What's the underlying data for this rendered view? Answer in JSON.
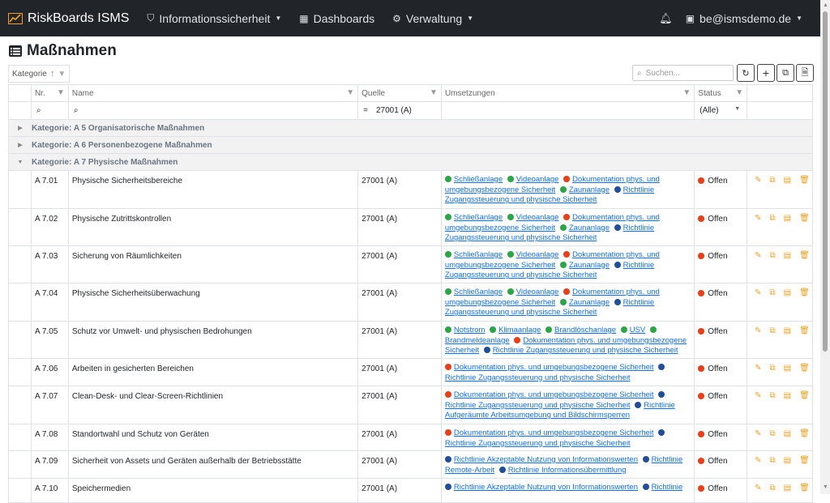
{
  "nav": {
    "brand": "RiskBoards ISMS",
    "items": [
      {
        "label": "Informationssicherheit",
        "icon": "shield-icon"
      },
      {
        "label": "Dashboards",
        "icon": "grid-icon"
      },
      {
        "label": "Verwaltung",
        "icon": "gear-icon"
      }
    ],
    "user": "be@ismsdemo.de"
  },
  "page": {
    "title": "Maßnahmen"
  },
  "toolbar": {
    "group_label": "Kategorie",
    "search_placeholder": "Suchen..."
  },
  "columns": {
    "nr": "Nr.",
    "name": "Name",
    "quelle": "Quelle",
    "umsetzungen": "Umsetzungen",
    "status": "Status"
  },
  "filters": {
    "quelle": "27001 (A)",
    "status": "(Alle)"
  },
  "colors": {
    "green": "#28a745",
    "red": "#f03c14",
    "blue": "#1f4e9c",
    "action": "#f0a020"
  },
  "groups": [
    {
      "label": "Kategorie: A 5 Organisatorische Maßnahmen",
      "expanded": false
    },
    {
      "label": "Kategorie: A 6 Personenbezogene Maßnahmen",
      "expanded": false
    },
    {
      "label": "Kategorie: A 7 Physische Maßnahmen",
      "expanded": true
    }
  ],
  "rows": [
    {
      "nr": "A 7.01",
      "name": "Physische Sicherheitsbereiche",
      "quelle": "27001 (A)",
      "status": "Offen",
      "impl": [
        [
          "green",
          "Schließanlage"
        ],
        [
          "green",
          "Videoanlage"
        ],
        [
          "red",
          "Dokumentation phys. und umgebungsbezogene Sicherheit"
        ],
        [
          "green",
          "Zaunanlage"
        ],
        [
          "blue",
          "Richtlinie Zugangssteuerung und physische Sicherheit"
        ]
      ]
    },
    {
      "nr": "A 7.02",
      "name": "Physische Zutrittskontrollen",
      "quelle": "27001 (A)",
      "status": "Offen",
      "impl": [
        [
          "green",
          "Schließanlage"
        ],
        [
          "green",
          "Videoanlage"
        ],
        [
          "red",
          "Dokumentation phys. und umgebungsbezogene Sicherheit"
        ],
        [
          "green",
          "Zaunanlage"
        ],
        [
          "blue",
          "Richtlinie Zugangssteuerung und physische Sicherheit"
        ]
      ]
    },
    {
      "nr": "A 7.03",
      "name": "Sicherung von Räumlichkeiten",
      "quelle": "27001 (A)",
      "status": "Offen",
      "impl": [
        [
          "green",
          "Schließanlage"
        ],
        [
          "green",
          "Videoanlage"
        ],
        [
          "red",
          "Dokumentation phys. und umgebungsbezogene Sicherheit"
        ],
        [
          "green",
          "Zaunanlage"
        ],
        [
          "blue",
          "Richtlinie Zugangssteuerung und physische Sicherheit"
        ]
      ]
    },
    {
      "nr": "A 7.04",
      "name": "Physische Sicherheitsüberwachung",
      "quelle": "27001 (A)",
      "status": "Offen",
      "impl": [
        [
          "green",
          "Schließanlage"
        ],
        [
          "green",
          "Videoanlage"
        ],
        [
          "red",
          "Dokumentation phys. und umgebungsbezogene Sicherheit"
        ],
        [
          "green",
          "Zaunanlage"
        ],
        [
          "blue",
          "Richtlinie Zugangssteuerung und physische Sicherheit"
        ]
      ]
    },
    {
      "nr": "A 7.05",
      "name": "Schutz vor Umwelt- und physischen Bedrohungen",
      "quelle": "27001 (A)",
      "status": "Offen",
      "impl": [
        [
          "green",
          "Notstrom"
        ],
        [
          "green",
          "Klimaanlage"
        ],
        [
          "green",
          "Brandlöschanlage"
        ],
        [
          "green",
          "USV"
        ],
        [
          "green",
          "Brandmeldeanlage"
        ],
        [
          "red",
          "Dokumentation phys. und umgebungsbezogene Sicherheit"
        ],
        [
          "blue",
          "Richtlinie Zugangssteuerung und physische Sicherheit"
        ]
      ]
    },
    {
      "nr": "A 7.06",
      "name": "Arbeiten in gesicherten Bereichen",
      "quelle": "27001 (A)",
      "status": "Offen",
      "impl": [
        [
          "red",
          "Dokumentation phys. und umgebungsbezogene Sicherheit"
        ],
        [
          "blue",
          "Richtlinie Zugangssteuerung und physische Sicherheit"
        ]
      ]
    },
    {
      "nr": "A 7.07",
      "name": "Clean-Desk- und Clear-Screen-Richtlinien",
      "quelle": "27001 (A)",
      "status": "Offen",
      "impl": [
        [
          "red",
          "Dokumentation phys. und umgebungsbezogene Sicherheit"
        ],
        [
          "blue",
          "Richtlinie Zugangssteuerung und physische Sicherheit"
        ],
        [
          "blue",
          "Richtlinie Aufgeräumte Arbeitsumgebung und Bildschirmsperren"
        ]
      ]
    },
    {
      "nr": "A 7.08",
      "name": "Standortwahl und Schutz von Geräten",
      "quelle": "27001 (A)",
      "status": "Offen",
      "impl": [
        [
          "red",
          "Dokumentation phys. und umgebungsbezogene Sicherheit"
        ],
        [
          "blue",
          "Richtlinie Zugangssteuerung und physische Sicherheit"
        ]
      ]
    },
    {
      "nr": "A 7.09",
      "name": "Sicherheit von Assets und Geräten außerhalb der Betriebsstätte",
      "quelle": "27001 (A)",
      "status": "Offen",
      "impl": [
        [
          "blue",
          "Richtlinie Akzeptable Nutzung von Informationswerten"
        ],
        [
          "blue",
          "Richtlinie Remote-Arbeit"
        ],
        [
          "blue",
          "Richtlinie Informationsübermittlung"
        ]
      ]
    },
    {
      "nr": "A 7.10",
      "name": "Speichermedien",
      "quelle": "27001 (A)",
      "status": "Offen",
      "impl": [
        [
          "blue",
          "Richtlinie Akzeptable Nutzung von Informationswerten"
        ],
        [
          "blue",
          "Richtlinie"
        ]
      ]
    }
  ]
}
